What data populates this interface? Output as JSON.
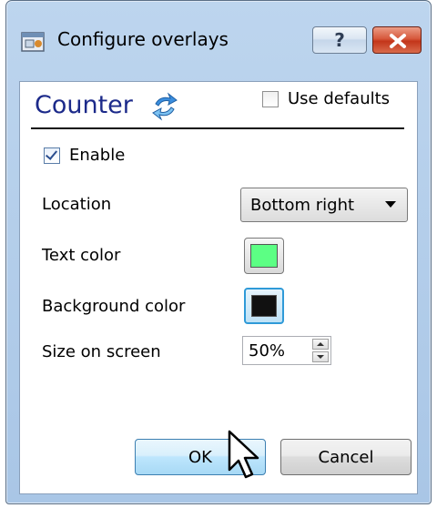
{
  "window": {
    "title": "Configure overlays",
    "help_label": "?"
  },
  "header": {
    "heading": "Counter",
    "use_defaults_label": "Use defaults",
    "use_defaults_checked": false
  },
  "form": {
    "enable_label": "Enable",
    "enable_checked": true,
    "location_label": "Location",
    "location_value": "Bottom right",
    "text_color_label": "Text color",
    "text_color": "#5cff84",
    "background_color_label": "Background color",
    "background_color": "#111111",
    "size_label": "Size on screen",
    "size_value": "50%"
  },
  "buttons": {
    "ok_label": "OK",
    "cancel_label": "Cancel"
  },
  "colors": {
    "heading": "#1c2a8a",
    "close_button": "#c3351a",
    "frame": "#a9c6e6"
  }
}
